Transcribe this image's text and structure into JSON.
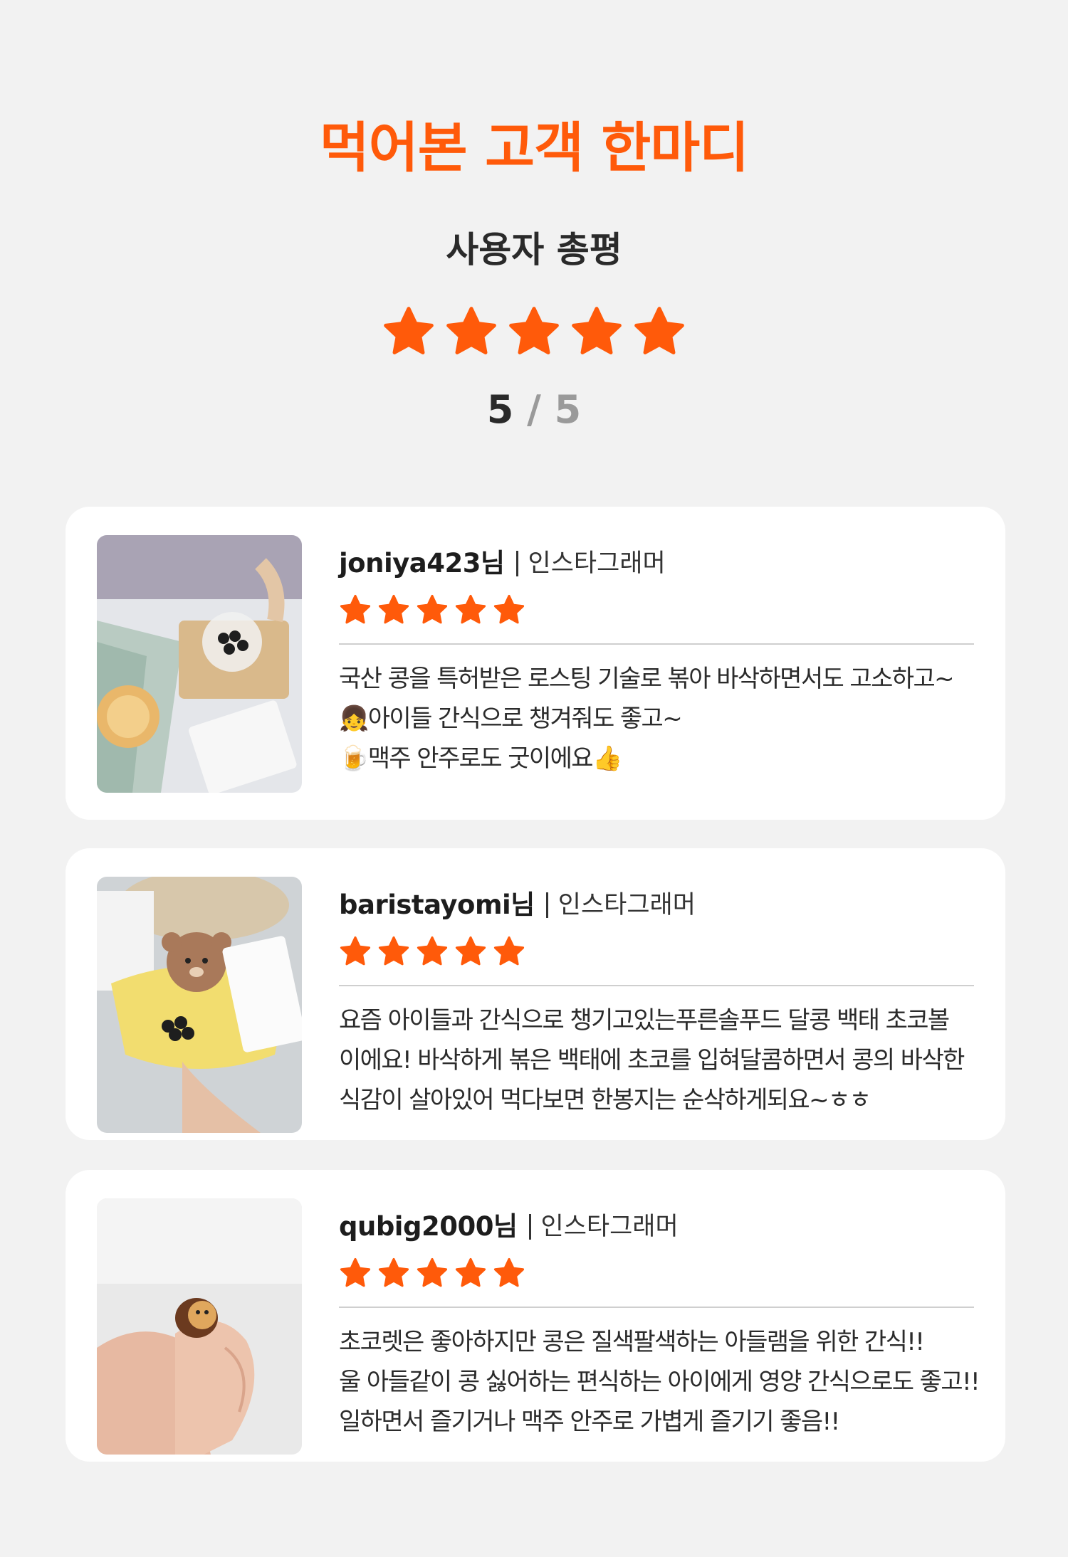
{
  "header": {
    "title": "먹어본 고객 한마디",
    "subtitle": "사용자 총평",
    "rating": 5,
    "score_value": "5",
    "score_separator": "/",
    "score_max": "5"
  },
  "colors": {
    "accent": "#ff5a0a",
    "background": "#f2f2f2",
    "card": "#ffffff"
  },
  "reviews": [
    {
      "username": "joniya423님",
      "role": "인스타그래머",
      "rating": 5,
      "lines": [
        "국산 콩을 특허받은 로스팅 기술로 볶아 바삭하면서도 고소하고~",
        "👧아이들 간식으로 챙겨줘도 좋고~",
        "🍺맥주 안주로도 굿이에요👍"
      ]
    },
    {
      "username": "baristayomi님",
      "role": "인스타그래머",
      "rating": 5,
      "lines": [
        "요즘 아이들과 간식으로 챙기고있는푸른솔푸드 달콩 백태 초코볼",
        "이에요! 바삭하게 볶은 백태에 초코를 입혀달콤하면서 콩의 바삭한",
        "식감이 살아있어 먹다보면 한봉지는 순삭하게되요~ㅎㅎ"
      ]
    },
    {
      "username": "qubig2000님",
      "role": "인스타그래머",
      "rating": 5,
      "lines": [
        "초코렛은 좋아하지만 콩은 질색팔색하는 아들램을 위한 간식!!",
        "울 아들같이 콩 싫어하는 편식하는 아이에게 영양 간식으로도 좋고!!",
        "일하면서 즐기거나 맥주 안주로 가볍게 즐기기 좋음!!"
      ]
    }
  ]
}
